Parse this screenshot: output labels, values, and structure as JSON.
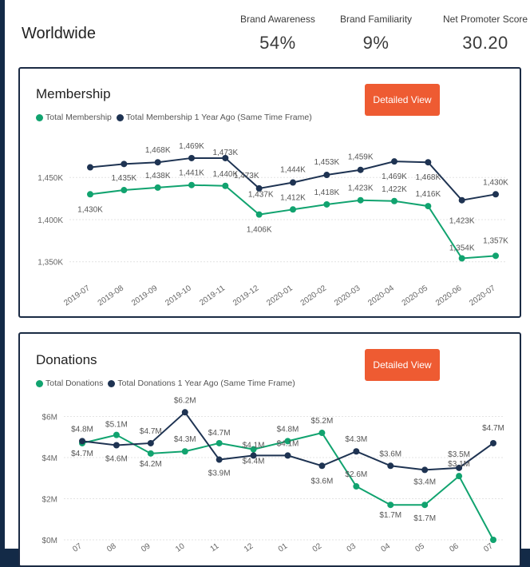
{
  "header": {
    "region": "Worldwide",
    "kpis": [
      {
        "label": "Brand Awareness",
        "value": "54%"
      },
      {
        "label": "Brand Familiarity",
        "value": "9%"
      },
      {
        "label": "Net Promoter Score",
        "value": "30.20"
      }
    ]
  },
  "colors": {
    "current": "#11a36f",
    "previous": "#1e3352",
    "button": "#ee5b32"
  },
  "membership": {
    "title": "Membership",
    "button": "Detailed View",
    "legend": [
      "Total Membership",
      "Total Membership 1 Year Ago (Same Time Frame)"
    ]
  },
  "donations": {
    "title": "Donations",
    "button": "Detailed View",
    "legend": [
      "Total Donations",
      "Total Donations 1 Year Ago (Same Time  Frame)"
    ]
  },
  "chart_data": [
    {
      "type": "line",
      "title": "Membership",
      "categories": [
        "2019-07",
        "2019-08",
        "2019-09",
        "2019-10",
        "2019-11",
        "2019-12",
        "2020-01",
        "2020-02",
        "2020-03",
        "2020-04",
        "2020-05",
        "2020-06",
        "2020-07"
      ],
      "series": [
        {
          "name": "Total Membership",
          "values": [
            1430,
            1435,
            1438,
            1441,
            1440,
            1406,
            1412,
            1418,
            1423,
            1422,
            1416,
            1354,
            1357
          ],
          "labels": [
            "1,430K",
            "1,435K",
            "1,438K",
            "1,441K",
            "1,440K",
            "1,406K",
            "1,412K",
            "1,418K",
            "1,423K",
            "1,422K",
            "1,416K",
            "1,354K",
            "1,357K"
          ]
        },
        {
          "name": "Total Membership 1 Year Ago (Same Time Frame)",
          "values": [
            1462,
            1466,
            1468,
            1473,
            1473,
            1437,
            1444,
            1453,
            1459,
            1469,
            1468,
            1423,
            1430
          ],
          "labels": [
            "",
            "",
            "1,468K",
            "1,469K",
            "1,473K",
            "1,473K",
            "1,444K",
            "1,453K",
            "1,459K",
            "1,469K",
            "1,468K",
            "1,423K",
            "1,430K"
          ],
          "extra_labels": [
            "1,437K"
          ]
        }
      ],
      "yticks": [
        "1,350K",
        "1,400K",
        "1,450K"
      ],
      "ylim": [
        1345,
        1490
      ],
      "grid": true
    },
    {
      "type": "line",
      "title": "Donations",
      "categories": [
        "2019-07",
        "2019-08",
        "2019-09",
        "2019-10",
        "2019-11",
        "2019-12",
        "2020-01",
        "2020-02",
        "2020-03",
        "2020-04",
        "2020-05",
        "2020-06",
        "2020-07"
      ],
      "tick_labels": [
        "07",
        "08",
        "09",
        "10",
        "11",
        "12",
        "01",
        "02",
        "03",
        "04",
        "05",
        "06",
        "07"
      ],
      "series": [
        {
          "name": "Total Donations",
          "values": [
            4.7,
            5.1,
            4.2,
            4.3,
            4.7,
            4.4,
            4.8,
            5.2,
            2.6,
            1.7,
            1.7,
            3.1,
            0.0
          ],
          "labels": [
            "$4.7M",
            "$5.1M",
            "$4.2M",
            "$4.3M",
            "$4.7M",
            "$4.4M",
            "$4.8M",
            "$5.2M",
            "$2.6M",
            "$1.7M",
            "$1.7M",
            "$3.1M",
            ""
          ]
        },
        {
          "name": "Total Donations 1 Year Ago (Same Time  Frame)",
          "values": [
            4.8,
            4.6,
            4.7,
            6.2,
            3.9,
            4.1,
            4.1,
            3.6,
            4.3,
            3.6,
            3.4,
            3.5,
            4.7
          ],
          "labels": [
            "$4.8M",
            "$4.6M",
            "$4.7M",
            "$6.2M",
            "$3.9M",
            "$4.1M",
            "$4.1M",
            "$3.6M",
            "$4.3M",
            "$3.6M",
            "$3.4M",
            "$3.5M",
            "$4.7M"
          ]
        }
      ],
      "yticks": [
        "$0M",
        "$2M",
        "$4M",
        "$6M"
      ],
      "ylim": [
        0,
        6.6
      ],
      "grid": true
    }
  ]
}
